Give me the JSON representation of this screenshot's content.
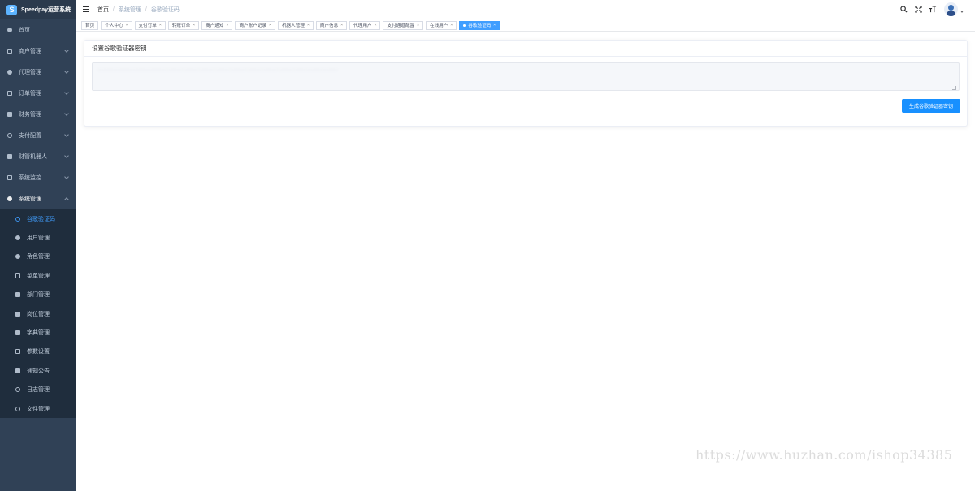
{
  "app": {
    "title": "Speedpay运营系统",
    "logo_glyph": "S",
    "colors": {
      "sidebar": "#304156",
      "accent": "#409eff",
      "button": "#1890ff"
    }
  },
  "sidebar": {
    "items": [
      {
        "label": "首页",
        "icon": "dashboard-icon"
      },
      {
        "label": "商户管理",
        "icon": "merchant-icon"
      },
      {
        "label": "代理管理",
        "icon": "agent-icon"
      },
      {
        "label": "订单管理",
        "icon": "order-icon"
      },
      {
        "label": "财务管理",
        "icon": "finance-icon"
      },
      {
        "label": "支付配置",
        "icon": "payment-config-icon"
      },
      {
        "label": "财管机器人",
        "icon": "robot-icon"
      },
      {
        "label": "系统监控",
        "icon": "monitor-icon"
      },
      {
        "label": "系统管理",
        "icon": "gear-icon"
      }
    ],
    "submenu": [
      {
        "label": "谷歌验证码",
        "icon": "google-auth-icon",
        "active": true
      },
      {
        "label": "用户管理",
        "icon": "user-icon"
      },
      {
        "label": "角色管理",
        "icon": "role-icon"
      },
      {
        "label": "菜单管理",
        "icon": "menu-tree-icon"
      },
      {
        "label": "部门管理",
        "icon": "department-icon"
      },
      {
        "label": "岗位管理",
        "icon": "post-icon"
      },
      {
        "label": "字典管理",
        "icon": "dictionary-icon"
      },
      {
        "label": "参数设置",
        "icon": "settings-edit-icon"
      },
      {
        "label": "通知公告",
        "icon": "notice-icon"
      },
      {
        "label": "日志管理",
        "icon": "log-icon"
      },
      {
        "label": "文件管理",
        "icon": "cloud-file-icon"
      }
    ]
  },
  "navbar": {
    "breadcrumb": [
      "首页",
      "系统管理",
      "谷歌验证码"
    ],
    "icons": [
      "search-icon",
      "fullscreen-icon",
      "font-size-icon"
    ]
  },
  "tags": [
    {
      "label": "首页",
      "closable": false
    },
    {
      "label": "个人中心",
      "closable": true
    },
    {
      "label": "支付订单",
      "closable": true
    },
    {
      "label": "转账订单",
      "closable": true
    },
    {
      "label": "商户通知",
      "closable": true
    },
    {
      "label": "商户账户记录",
      "closable": true
    },
    {
      "label": "机器人管理",
      "closable": true
    },
    {
      "label": "商户信息",
      "closable": true
    },
    {
      "label": "代理用户",
      "closable": true
    },
    {
      "label": "支付通道配置",
      "closable": true
    },
    {
      "label": "在线用户",
      "closable": true
    },
    {
      "label": "谷歌验证码",
      "closable": true,
      "active": true
    }
  ],
  "main": {
    "card_title": "设置谷歌验证器密钥",
    "secret_value": "············································································",
    "generate_button": "生成谷歌验证器密钥"
  },
  "watermark": "https://www.huzhan.com/ishop34385"
}
